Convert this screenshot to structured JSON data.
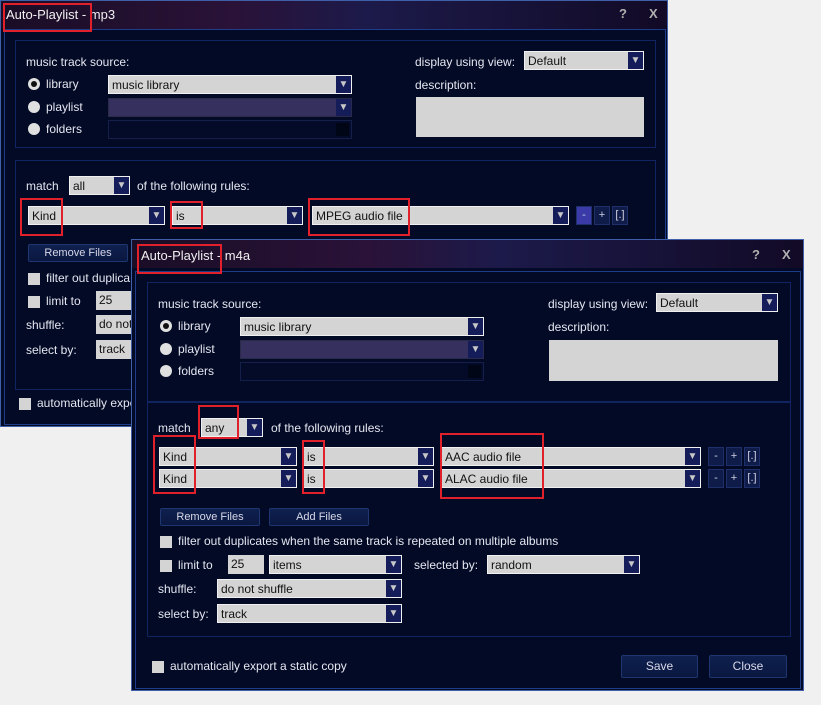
{
  "win1": {
    "title": "Auto-Playlist - mp3",
    "help": "?",
    "close": "X",
    "source_label": "music track source:",
    "library": "library",
    "playlist": "playlist",
    "folders": "folders",
    "library_value": "music library",
    "view_label": "display using view:",
    "view_value": "Default",
    "desc_label": "description:",
    "match_label": "match",
    "match_value": "all",
    "rules_label": "of the following rules:",
    "rules": [
      {
        "field": "Kind",
        "op": "is",
        "value": "MPEG audio file"
      }
    ],
    "remove_files": "Remove Files",
    "filter_dups": "filter out duplica",
    "limit_to": "limit to",
    "limit_value": "25",
    "shuffle_label": "shuffle:",
    "shuffle_value": "do not",
    "select_by_label": "select by:",
    "select_by_value": "track",
    "auto_export": "automatically expo"
  },
  "win2": {
    "title": "Auto-Playlist - m4a",
    "help": "?",
    "close": "X",
    "source_label": "music track source:",
    "library": "library",
    "playlist": "playlist",
    "folders": "folders",
    "library_value": "music library",
    "view_label": "display using view:",
    "view_value": "Default",
    "desc_label": "description:",
    "match_label": "match",
    "match_value": "any",
    "rules_label": "of the following rules:",
    "rules": [
      {
        "field": "Kind",
        "op": "is",
        "value": "AAC audio file"
      },
      {
        "field": "Kind",
        "op": "is",
        "value": "ALAC audio file"
      }
    ],
    "remove_files": "Remove Files",
    "add_files": "Add Files",
    "filter_dups": "filter out duplicates when the same track is repeated on multiple albums",
    "limit_to": "limit to",
    "limit_value": "25",
    "limit_unit": "items",
    "selected_by_label": "selected by:",
    "selected_by_value": "random",
    "shuffle_label": "shuffle:",
    "shuffle_value": "do not shuffle",
    "select_by_label": "select by:",
    "select_by_value": "track",
    "auto_export": "automatically export a static copy",
    "save": "Save",
    "close_btn": "Close"
  },
  "icons": {
    "dropdown_arrow": "▼",
    "remove_rule": "-",
    "add_rule": "+",
    "nest_rule": "[.]"
  }
}
